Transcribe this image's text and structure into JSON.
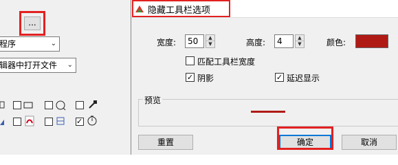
{
  "background": {
    "more_button_label": "...",
    "dropdown1_value": "程序",
    "dropdown2_value": "辑器中打开文件",
    "dropdown_arrow": "⌄",
    "checkbox_row1_checked": [
      false,
      false,
      false,
      false
    ],
    "checkbox_row2_checked": [
      false,
      false,
      false,
      true
    ]
  },
  "dialog": {
    "title": "隐藏工具栏选项",
    "width_label": "宽度:",
    "width_value": "50",
    "height_label": "高度:",
    "height_value": "4",
    "color_label": "颜色:",
    "color_value": "#b01a15",
    "fit_width_label": "匹配工具栏宽度",
    "fit_width_checked": false,
    "shadow_label": "阴影",
    "shadow_checked": true,
    "delay_label": "延迟显示",
    "delay_checked": true,
    "preview_label": "预览",
    "reset_button": "重置",
    "ok_button": "确定",
    "cancel_button": "取消",
    "check_mark": "✓",
    "spin_up": "▲",
    "spin_down": "▼"
  },
  "colors": {
    "highlight": "#e32020",
    "preview_line": "#b01a15",
    "default_button_border": "#0078d7"
  }
}
